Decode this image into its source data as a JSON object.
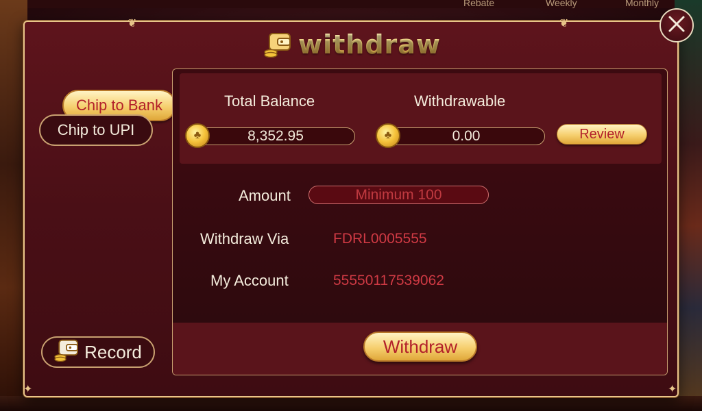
{
  "background": {
    "tabs": [
      "Rebate",
      "Weekly",
      "Monthly"
    ]
  },
  "dialog": {
    "title": "withdraw",
    "title_icon": "wallet-icon",
    "close_icon": "close-icon"
  },
  "sidebar": {
    "items": [
      {
        "label": "Chip to Bank",
        "active": true
      },
      {
        "label": "Chip to UPI",
        "active": false
      }
    ],
    "record_label": "Record",
    "record_icon": "wallet-icon"
  },
  "balance": {
    "total_label": "Total Balance",
    "total_value": "8,352.95",
    "withdrawable_label": "Withdrawable",
    "withdrawable_value": "0.00",
    "review_label": "Review",
    "coin_icon": "coin-icon"
  },
  "form": {
    "amount_label": "Amount",
    "amount_placeholder": "Minimum 100",
    "via_label": "Withdraw Via",
    "via_value": "FDRL0005555",
    "account_label": "My Account",
    "account_value": "55550117539062"
  },
  "actions": {
    "withdraw_label": "Withdraw"
  },
  "colors": {
    "accent_gold": "#f6cf6e",
    "button_text_red": "#b2202a",
    "value_red": "#d03a44",
    "dialog_bg": "#5e141c"
  }
}
